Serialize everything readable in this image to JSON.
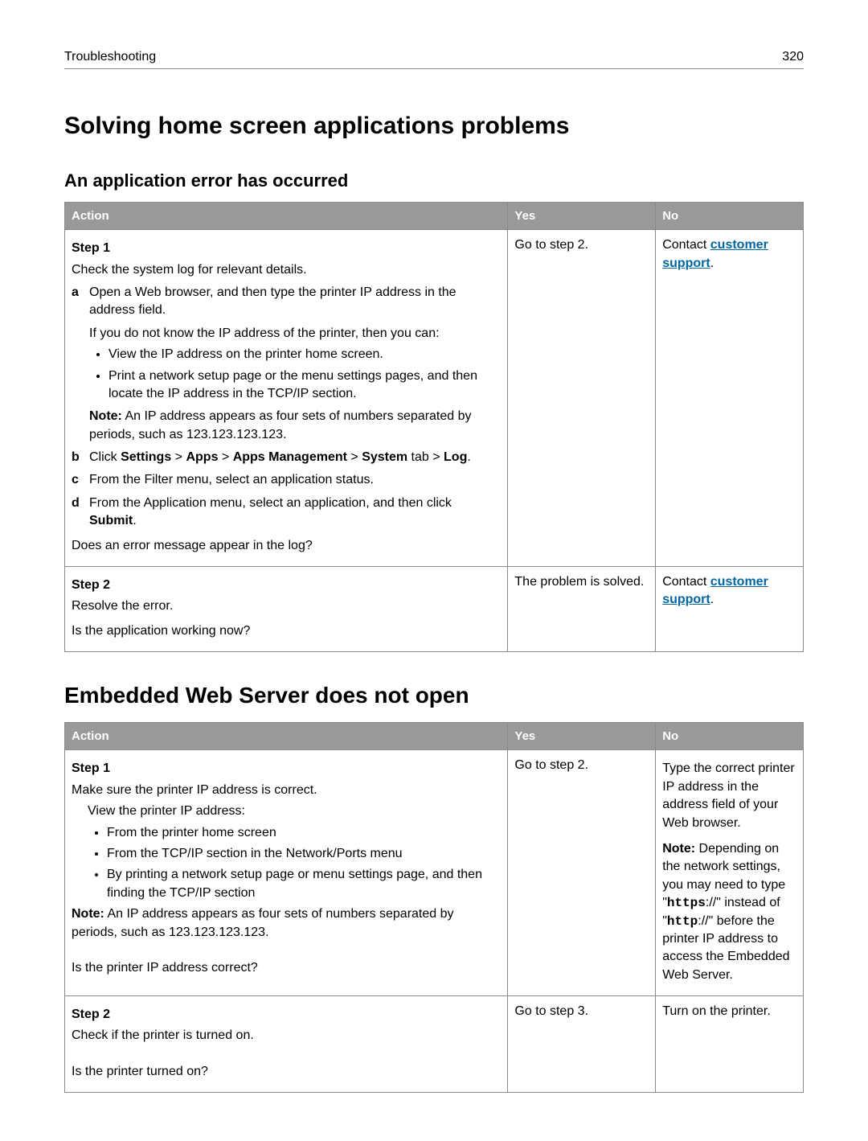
{
  "header": {
    "left": "Troubleshooting",
    "right": "320"
  },
  "h1": "Solving home screen applications problems",
  "sub1": "An application error has occurred",
  "cols": {
    "action": "Action",
    "yes": "Yes",
    "no": "No"
  },
  "t1": {
    "r1": {
      "step": "Step 1",
      "intro": "Check the system log for relevant details.",
      "a_marker": "a",
      "a_text": "Open a Web browser, and then type the printer IP address in the address field.",
      "a_sub": "If you do not know the IP address of the printer, then you can:",
      "a_b1": "View the IP address on the printer home screen.",
      "a_b2": "Print a network setup page or the menu settings pages, and then locate the IP address in the TCP/IP section.",
      "note_label": "Note:",
      "note_text": " An IP address appears as four sets of numbers separated by periods, such as 123.123.123.123.",
      "b_marker": "b",
      "b_pre": "Click ",
      "b_s": "Settings",
      "b_gt1": " > ",
      "b_a": "Apps",
      "b_gt2": " > ",
      "b_m": "Apps Management",
      "b_gt3": " > ",
      "b_sy": "System",
      "b_tab": " tab > ",
      "b_log": "Log",
      "b_dot": ".",
      "c_marker": "c",
      "c_text": "From the Filter menu, select an application status.",
      "d_marker": "d",
      "d_pre": "From the Application menu, select an application, and then click ",
      "d_submit": "Submit",
      "d_dot": ".",
      "question": "Does an error message appear in the log?",
      "yes": "Go to step 2.",
      "no_pre": "Contact ",
      "no_link": "customer support",
      "no_dot": "."
    },
    "r2": {
      "step": "Step 2",
      "body": "Resolve the error.",
      "question": "Is the application working now?",
      "yes": "The problem is solved.",
      "no_pre": "Contact ",
      "no_link": "customer support",
      "no_dot": "."
    }
  },
  "h2": "Embedded Web Server does not open",
  "t2": {
    "r1": {
      "step": "Step 1",
      "intro": "Make sure the printer IP address is correct.",
      "sub": "View the printer IP address:",
      "b1": "From the printer home screen",
      "b2": "From the TCP/IP section in the Network/Ports menu",
      "b3": "By printing a network setup page or menu settings page, and then finding the TCP/IP section",
      "note_label": "Note:",
      "note_text": " An IP address appears as four sets of numbers separated by periods, such as 123.123.123.123.",
      "question": "Is the printer IP address correct?",
      "yes": "Go to step 2.",
      "no_p1": "Type the correct printer IP address in the address field of your Web browser.",
      "no_note_label": "Note:",
      "no_note_pre": " Depending on the network settings, you may need to type \"",
      "no_https": "https",
      "no_mid": "://\" instead of \"",
      "no_http": "http",
      "no_post": "://\" before the printer IP address to access the Embedded Web Server."
    },
    "r2": {
      "step": "Step 2",
      "body": "Check if the printer is turned on.",
      "question": "Is the printer turned on?",
      "yes": "Go to step 3.",
      "no": "Turn on the printer."
    }
  }
}
